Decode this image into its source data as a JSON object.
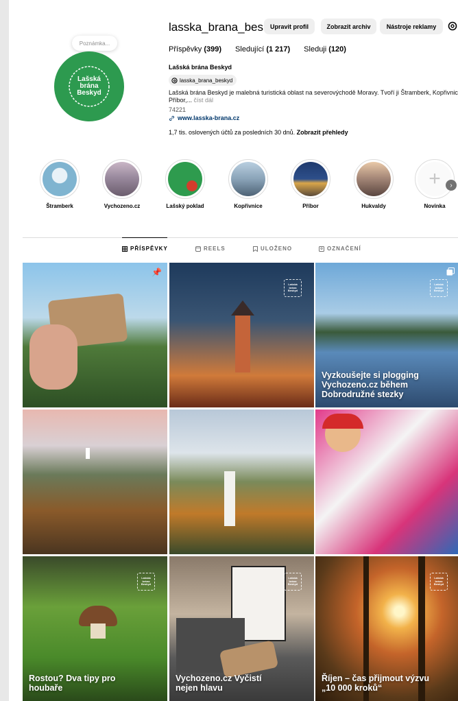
{
  "profile": {
    "note": "Poznámka...",
    "avatar_text": "Lašská brána Beskyd",
    "username": "lasska_brana_bes...",
    "buttons": {
      "edit": "Upravit profil",
      "archive": "Zobrazit archiv",
      "tools": "Nástroje reklamy"
    },
    "stats": {
      "posts_label": "Příspěvky",
      "posts_count": "(399)",
      "followers_label": "Sledující",
      "followers_count": "(1 217)",
      "following_label": "Sleduji",
      "following_count": "(120)"
    },
    "full_name": "Lašská brána Beskyd",
    "threads_handle": "lasska_brana_beskyd",
    "bio_text": "Lašská brána Beskyd je malebná turistická oblast na severovýchodě Moravy. Tvoří ji Štramberk, Kopřivnice, Příbor,...",
    "bio_more": "číst dál",
    "bio_code": "74221",
    "website": "www.lasska-brana.cz",
    "insights_text": "1,7 tis. oslovených účtů za posledních 30 dnů.",
    "insights_link": "Zobrazit přehledy"
  },
  "highlights": [
    {
      "label": "Štramberk"
    },
    {
      "label": "Vychozeno.cz"
    },
    {
      "label": "Lašský poklad"
    },
    {
      "label": "Kopřivnice"
    },
    {
      "label": "Příbor"
    },
    {
      "label": "Hukvaldy"
    },
    {
      "label": "Novinka"
    }
  ],
  "tabs": {
    "posts": "PŘÍSPĚVKY",
    "reels": "REELS",
    "saved": "ULOŽENO",
    "tagged": "OZNAČENÍ"
  },
  "posts": [
    {
      "caption": "",
      "stamp": ""
    },
    {
      "caption": "",
      "stamp": "Lašská brána Beskyd"
    },
    {
      "caption": "Vyzkoušejte si plogging Vychozeno.cz během Dobrodružné stezky",
      "stamp": "Lašská brána Beskyd"
    },
    {
      "caption": "",
      "stamp": ""
    },
    {
      "caption": "",
      "stamp": ""
    },
    {
      "caption": "",
      "stamp": ""
    },
    {
      "caption": "Rostou? Dva tipy pro houbaře",
      "stamp": "Lašská brána Beskyd"
    },
    {
      "caption": "Vychozeno.cz Vyčistí nejen hlavu",
      "stamp": "Lašská brána Beskyd"
    },
    {
      "caption": "Říjen – čas přijmout výzvu „10 000 kroků“",
      "stamp": "Lašská brána Beskyd"
    }
  ],
  "colors": {
    "brand_green": "#2d9a4f",
    "link_blue": "#00376b"
  }
}
